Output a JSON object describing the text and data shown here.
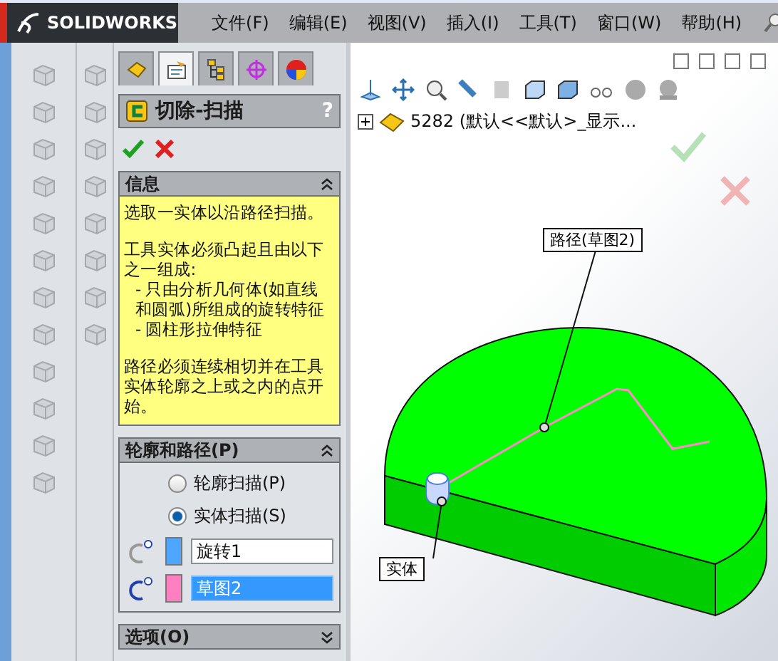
{
  "app": {
    "logo": "SOLIDWORKS"
  },
  "menu": [
    {
      "label": "文件(F)"
    },
    {
      "label": "编辑(E)"
    },
    {
      "label": "视图(V)"
    },
    {
      "label": "插入(I)"
    },
    {
      "label": "工具(T)"
    },
    {
      "label": "窗口(W)"
    },
    {
      "label": "帮助(H)"
    }
  ],
  "panel": {
    "tabs": [
      {
        "kind": "part",
        "selected": false
      },
      {
        "kind": "properties",
        "selected": true
      },
      {
        "kind": "config",
        "selected": false
      },
      {
        "kind": "crosshair",
        "selected": false
      },
      {
        "kind": "appearance",
        "selected": false
      }
    ],
    "title": "切除-扫描",
    "help": "?",
    "info": {
      "title": "信息",
      "expanded": true,
      "lines": [
        {
          "kind": "para",
          "text": "选取一实体以沿路径扫描。"
        },
        {
          "kind": "para",
          "text": "工具实体必须凸起且由以下之一组成:"
        },
        {
          "kind": "bullet",
          "text": "- 只由分析几何体(如直线和圆弧)所组成的旋转特征"
        },
        {
          "kind": "bullet",
          "text": "- 圆柱形拉伸特征"
        },
        {
          "kind": "para",
          "text": "路径必须连续相切并在工具实体轮廓之上或之内的点开始。"
        }
      ]
    },
    "profile_path": {
      "title": "轮廓和路径(P)",
      "expanded": true,
      "options": [
        {
          "label": "轮廓扫描(P)",
          "selected": false
        },
        {
          "label": "实体扫描(S)",
          "selected": true
        }
      ],
      "fields": [
        {
          "value": "旋转1",
          "color": "#4da6ff",
          "focused": false
        },
        {
          "value": "草图2",
          "color": "#ff80c0",
          "focused": true
        }
      ]
    },
    "options_section": {
      "title": "选项(O)",
      "expanded": false
    }
  },
  "viewport": {
    "tree": {
      "expanded": false,
      "label": "5282  (默认<<默认>_显示..."
    },
    "callouts": [
      {
        "kind": "path",
        "text": "路径(草图2)"
      },
      {
        "kind": "solid",
        "text": "实体"
      }
    ]
  }
}
